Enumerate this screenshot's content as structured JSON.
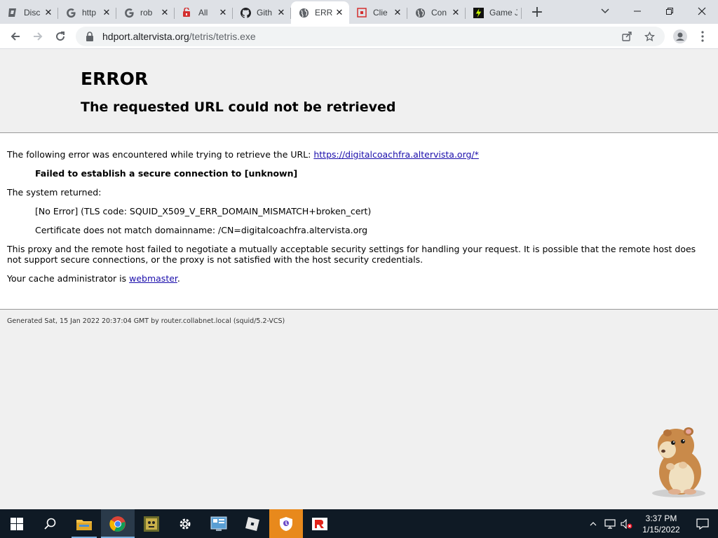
{
  "tabs": [
    {
      "title": "Disc",
      "icon": "discord-game-icon",
      "active": false
    },
    {
      "title": "http",
      "icon": "google-icon",
      "active": false
    },
    {
      "title": "rob",
      "icon": "google-icon",
      "active": false
    },
    {
      "title": "All",
      "icon": "roblox-lock-icon",
      "active": false
    },
    {
      "title": "Gith",
      "icon": "github-icon",
      "active": false
    },
    {
      "title": "ERR",
      "icon": "globe-icon",
      "active": true
    },
    {
      "title": "Clie",
      "icon": "roblox-icon",
      "active": false
    },
    {
      "title": "Con",
      "icon": "globe-icon",
      "active": false
    },
    {
      "title": "Game Jo",
      "icon": "game-jolt-icon",
      "active": false
    }
  ],
  "address_bar": {
    "host": "hdport.altervista.org",
    "path": "/tetris/tetris.exe"
  },
  "error_page": {
    "heading": "ERROR",
    "subheading": "The requested URL could not be retrieved",
    "intro": "The following error was encountered while trying to retrieve the URL: ",
    "url_link": "https://digitalcoachfra.altervista.org/*",
    "failure": "Failed to establish a secure connection to [unknown]",
    "system_returned": "The system returned:",
    "error_code": "[No Error] (TLS code: SQUID_X509_V_ERR_DOMAIN_MISMATCH+broken_cert)",
    "cert_msg": "Certificate does not match domainname: /CN=digitalcoachfra.altervista.org",
    "explanation": "This proxy and the remote host failed to negotiate a mutually acceptable security settings for handling your request. It is possible that the remote host does not support secure connections, or the proxy is not satisfied with the host security credentials.",
    "admin_prefix": "Your cache administrator is ",
    "admin_link": "webmaster",
    "admin_suffix": ".",
    "generated": "Generated Sat, 15 Jan 2022 20:37:04 GMT by router.collabnet.local (squid/5.2-VCS)"
  },
  "taskbar": {
    "apps": [
      "start-icon",
      "search-icon",
      "file-explorer-icon",
      "chrome-icon",
      "game-icon",
      "settings-icon",
      "control-panel-icon",
      "roblox-studio-icon",
      "vpn-shield-icon",
      "roblox-icon"
    ]
  },
  "clock": {
    "time": "3:37 PM",
    "date": "1/15/2022"
  },
  "colors": {
    "link": "#1a0dab",
    "tabstrip": "#dee1e6",
    "taskbar": "#0f1a25"
  }
}
